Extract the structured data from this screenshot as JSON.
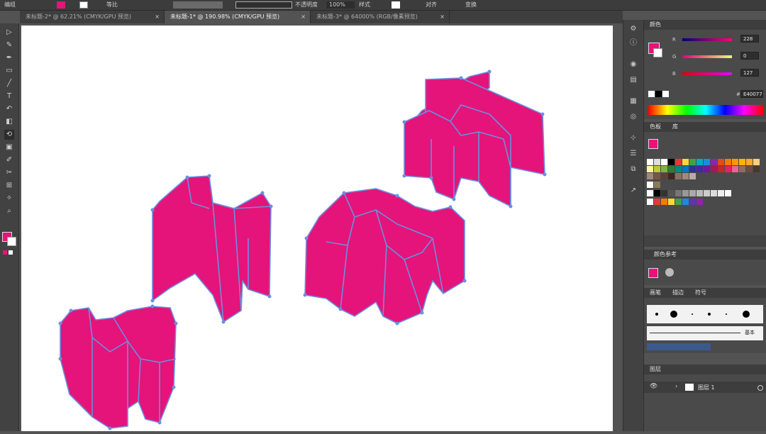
{
  "topbar": {
    "left_label": "编组",
    "stroke_profile": "等比",
    "opacity_label": "不透明度",
    "opacity_value": "100%",
    "style_label": "样式",
    "align_label": "对齐",
    "transform_label": "变换"
  },
  "tabs": [
    {
      "label": "未标题-2* @ 62.21% (CMYK/GPU 预览)",
      "active": false
    },
    {
      "label": "未标题-1* @ 190.98% (CMYK/GPU 预览)",
      "active": true
    },
    {
      "label": "未标题-3* @ 64000% (RGB/像素预览)",
      "active": false
    }
  ],
  "tab_close": "×",
  "tools": [
    "▷",
    "✎",
    "✒",
    "▭",
    "╱",
    "T",
    "↶",
    "◧",
    "⟲",
    "▣",
    "✐",
    "✂",
    "⊞",
    "✧",
    "⌕"
  ],
  "color_panel": {
    "title": "颜色",
    "channels": [
      {
        "label": "R",
        "value": "228"
      },
      {
        "label": "G",
        "value": "0"
      },
      {
        "label": "B",
        "value": "127"
      }
    ],
    "hex_label": "#",
    "hex_value": "E40077"
  },
  "swatches_panel": {
    "tab1": "色板",
    "tab2": "库"
  },
  "color_guide": {
    "title": "颜色参考"
  },
  "brush_panel": {
    "tab1": "画笔",
    "tab2": "描边",
    "tab3": "符号",
    "basic_label": "基本"
  },
  "layers_panel": {
    "title": "图层",
    "layer_name": "图层 1"
  },
  "colors": {
    "fill": "#e4147a",
    "accent_blue": "#6b8fe0",
    "canvas": "#ffffff"
  }
}
